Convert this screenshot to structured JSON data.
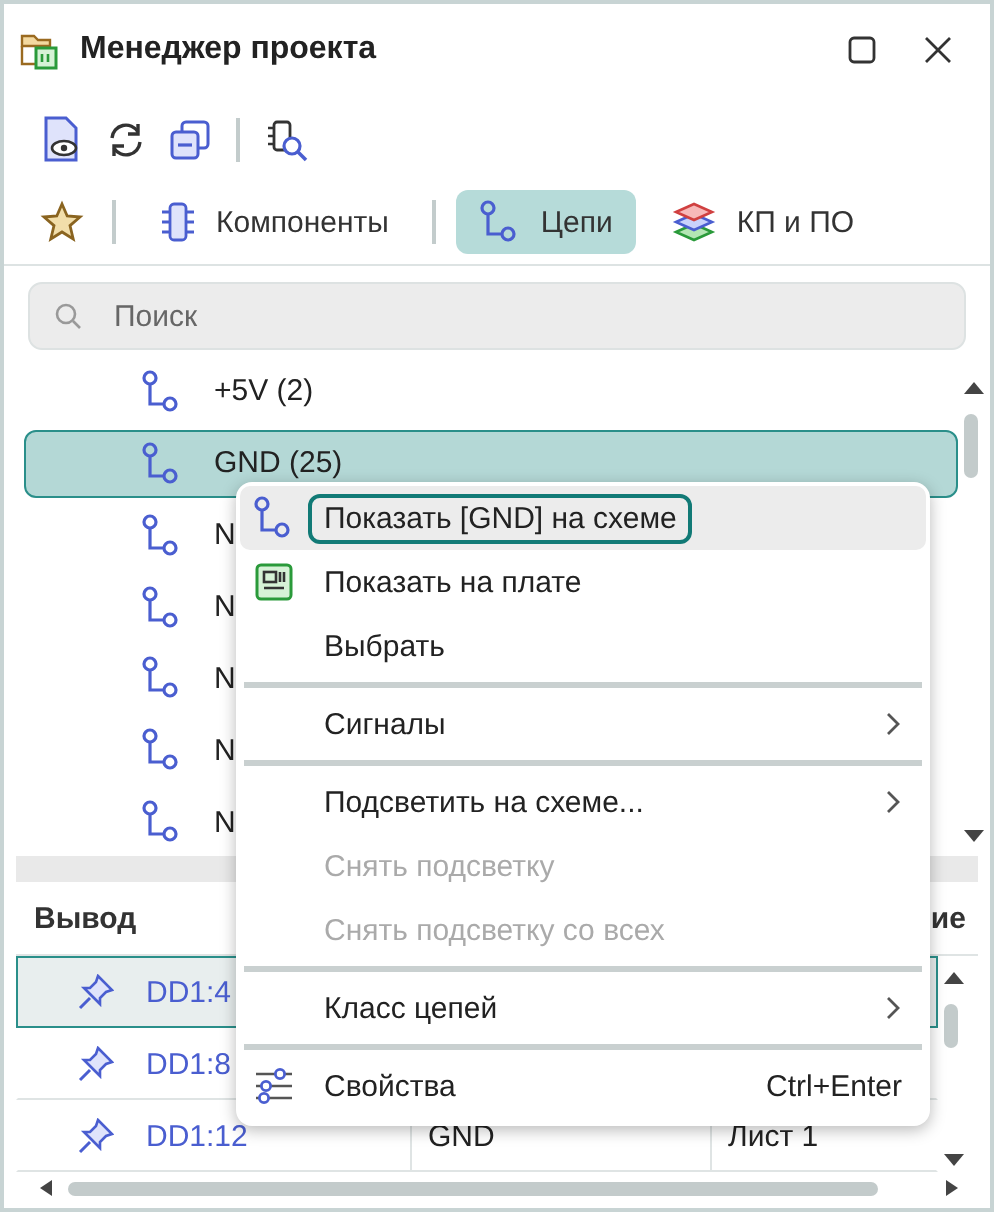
{
  "window": {
    "title": "Менеджер проекта"
  },
  "toolbar": {
    "buttons": [
      {
        "kind": "preview"
      },
      {
        "kind": "refresh"
      },
      {
        "kind": "collapse"
      },
      {
        "kind": "separator"
      },
      {
        "kind": "inspect"
      }
    ]
  },
  "tabs": [
    {
      "kind": "favorites",
      "selected": false
    },
    {
      "kind": "components",
      "label": "Компоненты",
      "selected": false
    },
    {
      "kind": "nets",
      "label": "Цепи",
      "selected": true
    },
    {
      "kind": "layers",
      "label": "КП и ПО",
      "selected": false
    }
  ],
  "search": {
    "placeholder": "Поиск"
  },
  "tree": {
    "items": [
      {
        "label": "+5V (2)",
        "selected": false
      },
      {
        "label": "GND (25)",
        "selected": true
      },
      {
        "label": "N",
        "selected": false
      },
      {
        "label": "N",
        "selected": false
      },
      {
        "label": "N",
        "selected": false
      },
      {
        "label": "N",
        "selected": false
      },
      {
        "label": "N",
        "selected": false
      }
    ]
  },
  "table": {
    "columns": [
      "Вывод",
      "",
      "ие"
    ],
    "rows": [
      {
        "cells": [
          "DD1:4",
          "",
          ""
        ],
        "selected": true
      },
      {
        "cells": [
          "DD1:8",
          "",
          ""
        ],
        "selected": false
      },
      {
        "cells": [
          "DD1:12",
          "GND",
          "Лист 1"
        ],
        "selected": false
      }
    ]
  },
  "context_menu": {
    "items": [
      {
        "kind": "item",
        "label": "Показать [GND] на схеме",
        "selected": true,
        "disabled": false,
        "submenu": false
      },
      {
        "kind": "item",
        "label": "Показать на плате",
        "selected": false,
        "disabled": false,
        "submenu": false
      },
      {
        "kind": "item",
        "label": "Выбрать",
        "selected": false,
        "disabled": false,
        "submenu": false
      },
      {
        "kind": "separator"
      },
      {
        "kind": "item",
        "label": "Сигналы",
        "selected": false,
        "disabled": false,
        "submenu": true
      },
      {
        "kind": "separator"
      },
      {
        "kind": "item",
        "label": "Подсветить на схеме...",
        "selected": false,
        "disabled": false,
        "submenu": true
      },
      {
        "kind": "item",
        "label": "Снять подсветку",
        "selected": false,
        "disabled": true,
        "submenu": false
      },
      {
        "kind": "item",
        "label": "Снять подсветку со всех",
        "selected": false,
        "disabled": true,
        "submenu": false
      },
      {
        "kind": "separator"
      },
      {
        "kind": "item",
        "label": "Класс цепей",
        "selected": false,
        "disabled": false,
        "submenu": true
      },
      {
        "kind": "separator"
      },
      {
        "kind": "item",
        "label": "Свойства",
        "shortcut": "Ctrl+Enter",
        "selected": false,
        "disabled": false,
        "submenu": false
      }
    ]
  }
}
